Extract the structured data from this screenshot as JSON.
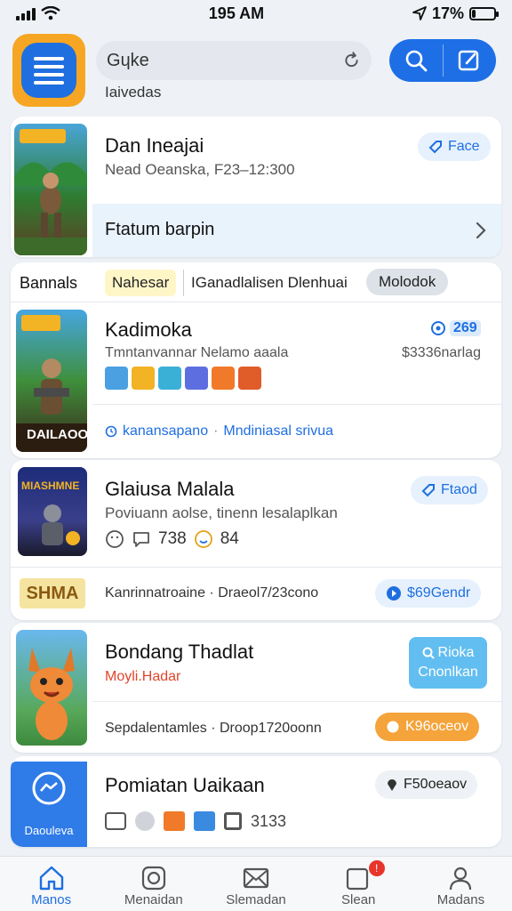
{
  "status": {
    "time": "195 AM",
    "battery": "17%",
    "battery_level": 0.17
  },
  "header": {
    "search_value": "Gɥke",
    "subtitle": "Iaivedas"
  },
  "card1": {
    "title": "Dan Ineajai",
    "meta": "Nead Oeanska, F23–12:300",
    "pill": "Face",
    "footer": "Ftatum barpin"
  },
  "filters": {
    "label": "Bannals",
    "chips": [
      "Nahesar",
      "IGanadlalisen Dlenhuai",
      "Molodok"
    ]
  },
  "card2": {
    "title": "Kadimoka",
    "meta": "Tmntanvannar Nelamo aaala",
    "price": "$3336narlag",
    "badge": "269",
    "thumb_caption": "DAILAOO",
    "link1": "kanansapano",
    "link2": "Mndiniasal srivua"
  },
  "card3": {
    "title": "Glaiusa Malala",
    "meta": "Poviuann aolse, tinenn lesalaplkan",
    "pill": "Ftaod",
    "count1": "738",
    "count2": "84",
    "thumb_caption": "MIASHMNE",
    "row_badge": "SHMA",
    "row_text": "Kanrinnatroaine · Draeol7/23cono",
    "row_pill": "$69Gendr"
  },
  "card4": {
    "title": "Bondang Thadlat",
    "meta": "Moyli.Hadar",
    "btn_line1": "Rioka",
    "btn_line2": "Cnonlkan",
    "footer": "Sepdalentamles · Droop1720oonn",
    "pill": "K96oceov"
  },
  "card5": {
    "title": "Pomiatan Uaikaan",
    "thumb_caption": "Daouleva",
    "pill": "F50oeaov",
    "count": "3133"
  },
  "tabs": [
    {
      "label": "Manos"
    },
    {
      "label": "Menaidan"
    },
    {
      "label": "Slemadan"
    },
    {
      "label": "Slean",
      "badge": "!"
    },
    {
      "label": "Madans"
    }
  ],
  "colors": {
    "accent": "#1f6fe0",
    "orange": "#f6a623",
    "red": "#e8352b"
  }
}
